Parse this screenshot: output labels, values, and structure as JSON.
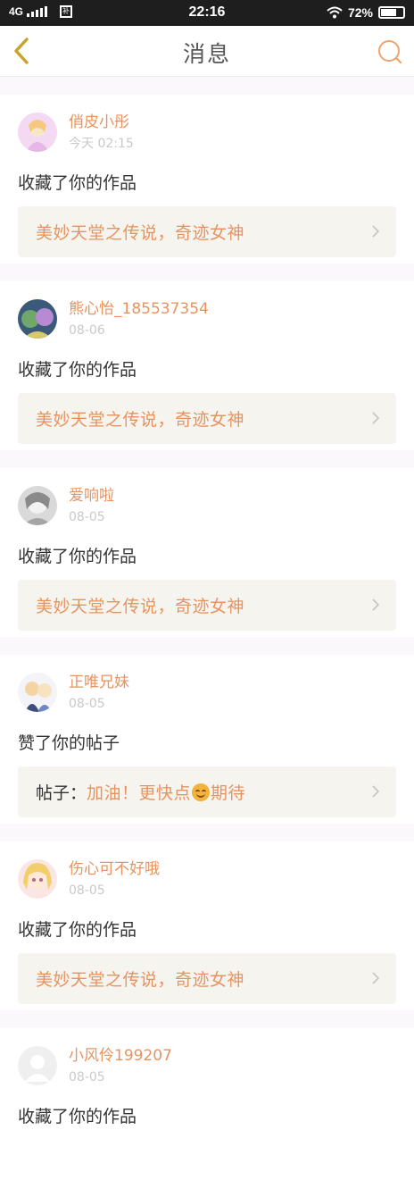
{
  "status_bar": {
    "network": "4G",
    "time": "22:16",
    "battery_percent": "72%",
    "battery_level": 0.72,
    "sim_icon_text": "补"
  },
  "header": {
    "title": "消息",
    "back_icon": "chevron-left-icon",
    "search_icon": "search-icon"
  },
  "colors": {
    "accent": "#e8935f",
    "status_bar": "#1e1e1e",
    "ref_background": "#f6f4ee",
    "page_background": "#fbf8fb"
  },
  "messages": [
    {
      "username": "俏皮小彤",
      "time": "今天 02:15",
      "action": "收藏了你的作品",
      "ref_prefix": "",
      "ref_text": "美妙天堂之传说，奇迹女神"
    },
    {
      "username": "熊心怡_185537354",
      "time": "08-06",
      "action": "收藏了你的作品",
      "ref_prefix": "",
      "ref_text": "美妙天堂之传说，奇迹女神"
    },
    {
      "username": "爱响啦",
      "time": "08-05",
      "action": "收藏了你的作品",
      "ref_prefix": "",
      "ref_text": "美妙天堂之传说，奇迹女神"
    },
    {
      "username": "正唯兄妹",
      "time": "08-05",
      "action": "赞了你的帖子",
      "ref_prefix": "帖子：",
      "ref_text": "加油！更快点",
      "ref_emoji": "smiling-face-emoji",
      "ref_text_after": "期待"
    },
    {
      "username": "伤心可不好哦",
      "time": "08-05",
      "action": "收藏了你的作品",
      "ref_prefix": "",
      "ref_text": "美妙天堂之传说，奇迹女神"
    },
    {
      "username": "小风伶199207",
      "time": "08-05",
      "action": "收藏了你的作品"
    }
  ]
}
